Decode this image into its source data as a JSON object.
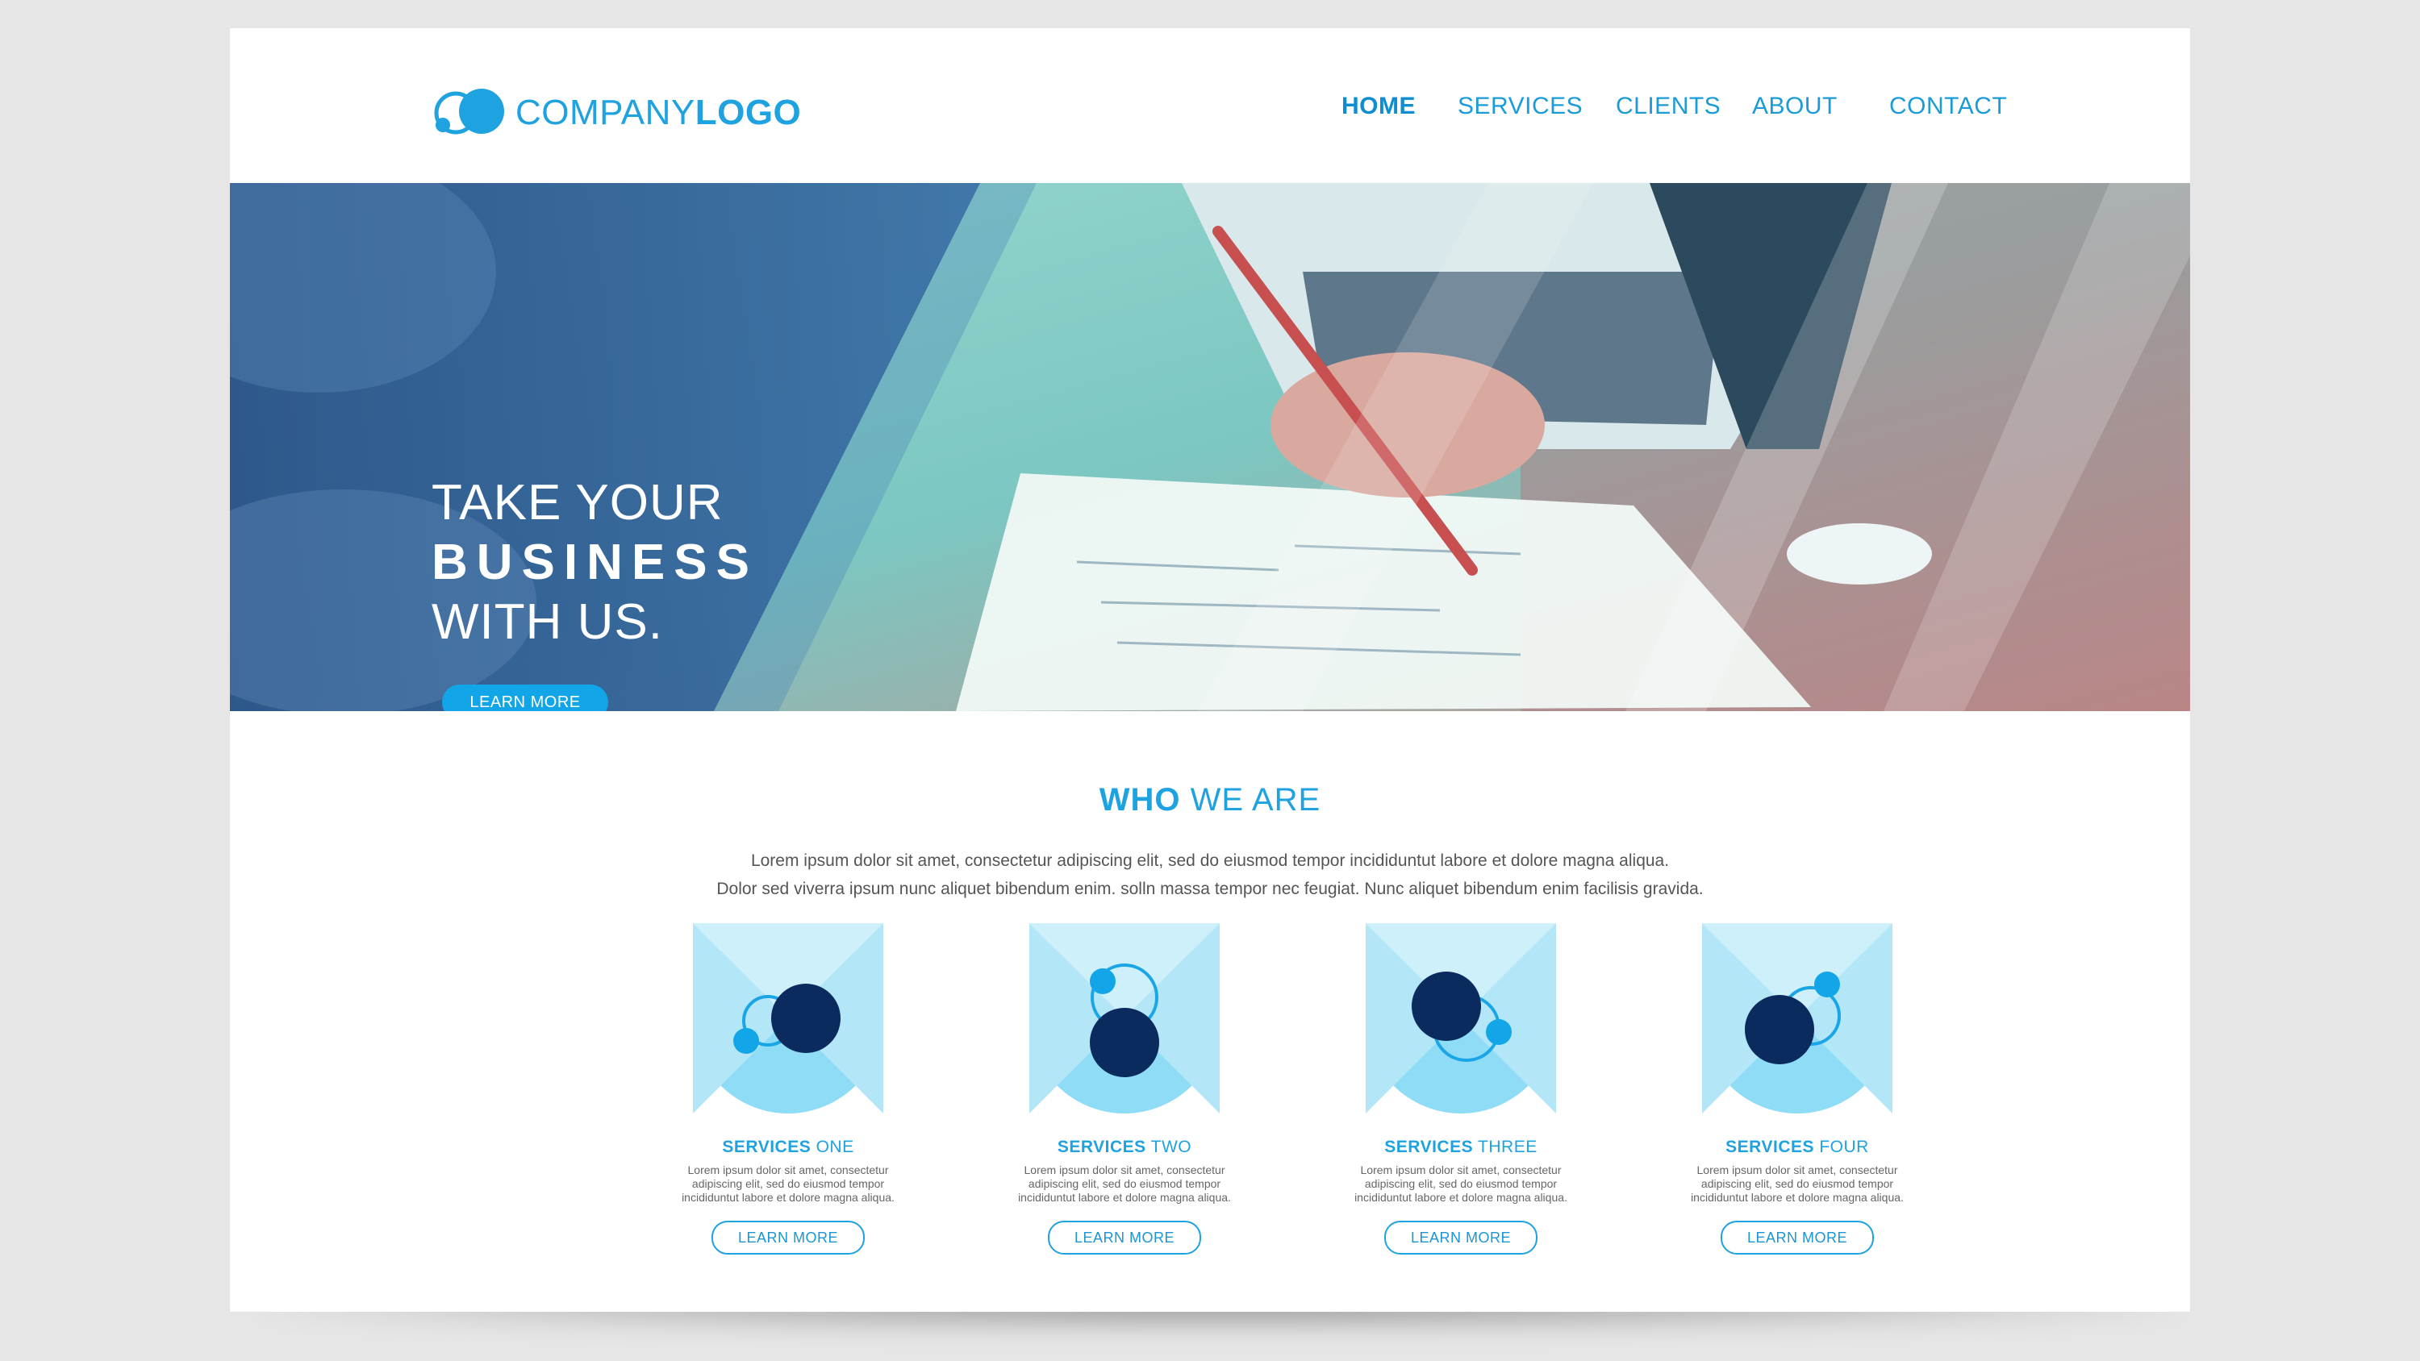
{
  "header": {
    "logo_main": "COMPANY",
    "logo_bold": "LOGO",
    "nav": [
      "HOME",
      "SERVICES",
      "CLIENTS",
      "ABOUT",
      "CONTACT"
    ],
    "active": "HOME"
  },
  "hero": {
    "line1": "TAKE YOUR",
    "line2": "BUSINESS",
    "line3": "WITH US.",
    "button": "LEARN MORE"
  },
  "who": {
    "title_bold": "WHO",
    "title_rest": " WE ARE",
    "text_line1": "Lorem ipsum dolor sit amet, consectetur adipiscing elit, sed do eiusmod tempor incididuntut labore et dolore magna aliqua.",
    "text_line2": "Dolor sed viverra ipsum nunc aliquet bibendum enim. solln massa tempor nec feugiat. Nunc aliquet bibendum enim facilisis gravida."
  },
  "services": [
    {
      "bold": "SERVICES",
      "rest": " ONE",
      "desc1": "Lorem ipsum dolor sit amet, consectetur",
      "desc2": "adipiscing elit,  sed do eiusmod tempor",
      "desc3": "incididuntut labore et dolore magna aliqua.",
      "button": "LEARN MORE"
    },
    {
      "bold": "SERVICES",
      "rest": " TWO",
      "desc1": "Lorem ipsum dolor sit amet, consectetur",
      "desc2": "adipiscing elit,  sed do eiusmod tempor",
      "desc3": "incididuntut labore et dolore magna aliqua.",
      "button": "LEARN MORE"
    },
    {
      "bold": "SERVICES",
      "rest": " THREE",
      "desc1": "Lorem ipsum dolor sit amet, consectetur",
      "desc2": "adipiscing elit,  sed do eiusmod tempor",
      "desc3": "incididuntut labore et dolore magna aliqua.",
      "button": "LEARN MORE"
    },
    {
      "bold": "SERVICES",
      "rest": " FOUR",
      "desc1": "Lorem ipsum dolor sit amet, consectetur",
      "desc2": "adipiscing elit,  sed do eiusmod tempor",
      "desc3": "incididuntut labore et dolore magna aliqua.",
      "button": "LEARN MORE"
    }
  ],
  "colors": {
    "accent": "#1fa2e0",
    "button": "#12a6e8",
    "navy": "#0b2a5e",
    "light_circle": "#b3e6f7"
  },
  "icons": [
    "company-logo-icon",
    "service-molecule-icon"
  ]
}
